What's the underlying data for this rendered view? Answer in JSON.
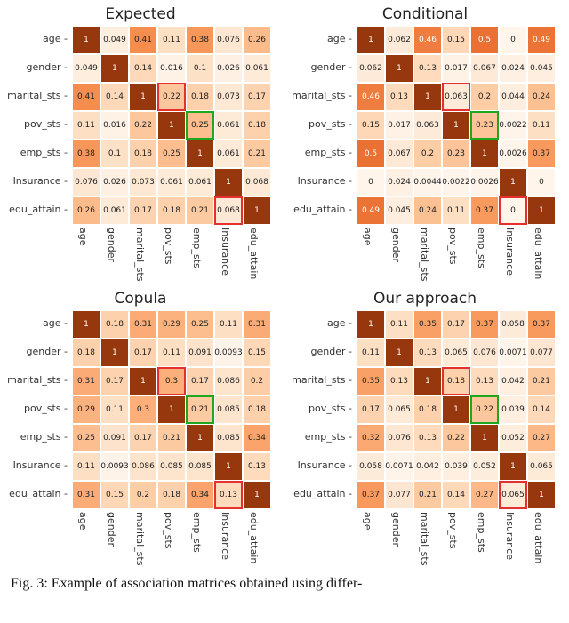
{
  "labels": [
    "age",
    "gender",
    "marital_sts",
    "pov_sts",
    "emp_sts",
    "Insurance",
    "edu_attain"
  ],
  "caption": "Fig. 3: Example of association matrices obtained using differ-",
  "chart_data": [
    {
      "type": "heatmap",
      "title": "Expected",
      "xlabels": [
        "age",
        "gender",
        "marital_sts",
        "pov_sts",
        "emp_sts",
        "Insurance",
        "edu_attain"
      ],
      "ylabels": [
        "age",
        "gender",
        "marital_sts",
        "pov_sts",
        "emp_sts",
        "Insurance",
        "edu_attain"
      ],
      "values": [
        [
          1,
          0.049,
          0.41,
          0.11,
          0.38,
          0.076,
          0.26
        ],
        [
          0.049,
          1,
          0.14,
          0.016,
          0.1,
          0.026,
          0.061
        ],
        [
          0.41,
          0.14,
          1,
          0.22,
          0.18,
          0.073,
          0.17
        ],
        [
          0.11,
          0.016,
          0.22,
          1,
          0.25,
          0.061,
          0.18
        ],
        [
          0.38,
          0.1,
          0.18,
          0.25,
          1,
          0.061,
          0.21
        ],
        [
          0.076,
          0.026,
          0.073,
          0.061,
          0.061,
          1,
          0.068
        ],
        [
          0.26,
          0.061,
          0.17,
          0.18,
          0.21,
          0.068,
          1
        ]
      ],
      "highlights": [
        {
          "row": 2,
          "col": 3,
          "kind": "red"
        },
        {
          "row": 3,
          "col": 4,
          "kind": "green"
        },
        {
          "row": 6,
          "col": 5,
          "kind": "red"
        }
      ]
    },
    {
      "type": "heatmap",
      "title": "Conditional",
      "xlabels": [
        "age",
        "gender",
        "marital_sts",
        "pov_sts",
        "emp_sts",
        "Insurance",
        "edu_attain"
      ],
      "ylabels": [
        "age",
        "gender",
        "marital_sts",
        "pov_sts",
        "emp_sts",
        "Insurance",
        "edu_attain"
      ],
      "values": [
        [
          1,
          0.062,
          0.46,
          0.15,
          0.5,
          0,
          0.49
        ],
        [
          0.062,
          1,
          0.13,
          0.017,
          0.067,
          0.024,
          0.045
        ],
        [
          0.46,
          0.13,
          1,
          0.063,
          0.2,
          0.044,
          0.24
        ],
        [
          0.15,
          0.017,
          0.063,
          1,
          0.23,
          0.0022,
          0.11
        ],
        [
          0.5,
          0.067,
          0.2,
          0.23,
          1,
          0.0026,
          0.37
        ],
        [
          0,
          0.024,
          0.0044,
          0.0022,
          0.0026,
          1,
          0
        ],
        [
          0.49,
          0.045,
          0.24,
          0.11,
          0.37,
          0,
          1
        ]
      ],
      "highlights": [
        {
          "row": 2,
          "col": 3,
          "kind": "red"
        },
        {
          "row": 3,
          "col": 4,
          "kind": "green"
        },
        {
          "row": 6,
          "col": 5,
          "kind": "red"
        }
      ]
    },
    {
      "type": "heatmap",
      "title": "Copula",
      "xlabels": [
        "age",
        "gender",
        "marital_sts",
        "pov_sts",
        "emp_sts",
        "Insurance",
        "edu_attain"
      ],
      "ylabels": [
        "age",
        "gender",
        "marital_sts",
        "pov_sts",
        "emp_sts",
        "Insurance",
        "edu_attain"
      ],
      "values": [
        [
          1,
          0.18,
          0.31,
          0.29,
          0.25,
          0.11,
          0.31
        ],
        [
          0.18,
          1,
          0.17,
          0.11,
          0.091,
          0.0093,
          0.15
        ],
        [
          0.31,
          0.17,
          1,
          0.3,
          0.17,
          0.086,
          0.2
        ],
        [
          0.29,
          0.11,
          0.3,
          1,
          0.21,
          0.085,
          0.18
        ],
        [
          0.25,
          0.091,
          0.17,
          0.21,
          1,
          0.085,
          0.34
        ],
        [
          0.11,
          0.0093,
          0.086,
          0.085,
          0.085,
          1,
          0.13
        ],
        [
          0.31,
          0.15,
          0.2,
          0.18,
          0.34,
          0.13,
          1
        ]
      ],
      "highlights": [
        {
          "row": 2,
          "col": 3,
          "kind": "red"
        },
        {
          "row": 3,
          "col": 4,
          "kind": "green"
        },
        {
          "row": 6,
          "col": 5,
          "kind": "red"
        }
      ]
    },
    {
      "type": "heatmap",
      "title": "Our approach",
      "xlabels": [
        "age",
        "gender",
        "marital_sts",
        "pov_sts",
        "emp_sts",
        "Insurance",
        "edu_attain"
      ],
      "ylabels": [
        "age",
        "gender",
        "marital_sts",
        "pov_sts",
        "emp_sts",
        "Insurance",
        "edu_attain"
      ],
      "values": [
        [
          1,
          0.11,
          0.35,
          0.17,
          0.37,
          0.058,
          0.37
        ],
        [
          0.11,
          1,
          0.13,
          0.065,
          0.076,
          0.0071,
          0.077
        ],
        [
          0.35,
          0.13,
          1,
          0.18,
          0.13,
          0.042,
          0.21
        ],
        [
          0.17,
          0.065,
          0.18,
          1,
          0.22,
          0.039,
          0.14
        ],
        [
          0.32,
          0.076,
          0.13,
          0.22,
          1,
          0.052,
          0.27
        ],
        [
          0.058,
          0.0071,
          0.042,
          0.039,
          0.052,
          1,
          0.065
        ],
        [
          0.37,
          0.077,
          0.21,
          0.14,
          0.27,
          0.065,
          1
        ]
      ],
      "highlights": [
        {
          "row": 2,
          "col": 3,
          "kind": "red"
        },
        {
          "row": 3,
          "col": 4,
          "kind": "green"
        },
        {
          "row": 6,
          "col": 5,
          "kind": "red"
        }
      ]
    }
  ]
}
